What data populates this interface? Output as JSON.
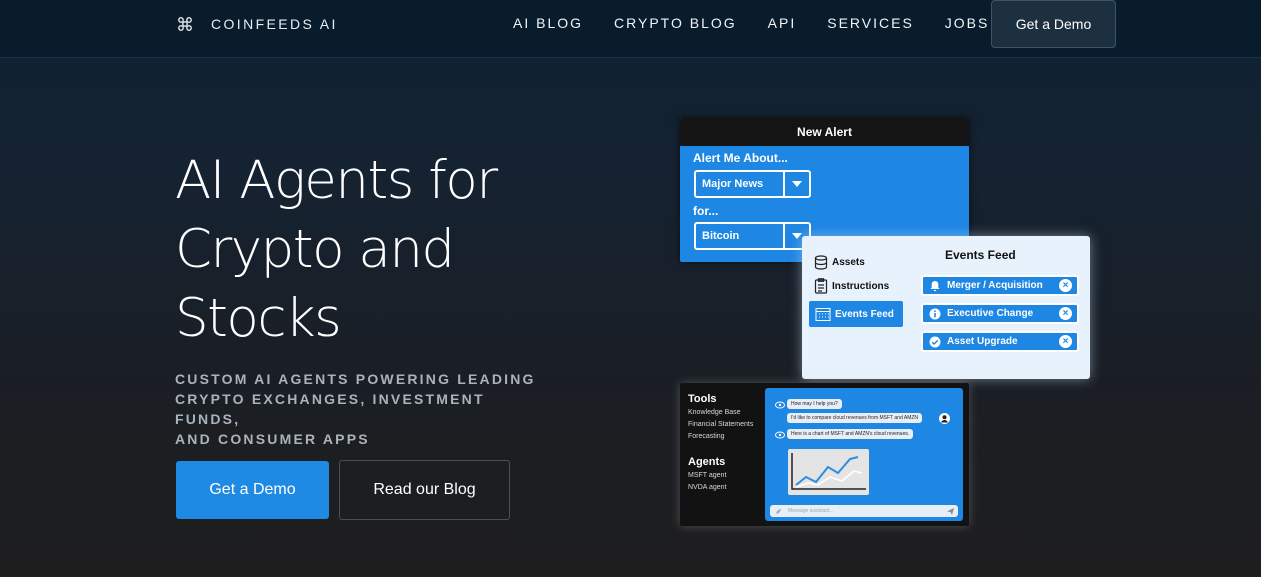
{
  "nav": {
    "brand": "COINFEEDS AI",
    "links": [
      "AI BLOG",
      "CRYPTO BLOG",
      "API",
      "SERVICES",
      "JOBS"
    ],
    "cta": "Get a Demo"
  },
  "hero": {
    "title_lines": [
      "AI Agents for",
      "Crypto and",
      "Stocks"
    ],
    "subtitle_lines": [
      "CUSTOM AI AGENTS POWERING LEADING",
      "CRYPTO EXCHANGES, INVESTMENT FUNDS,",
      "AND CONSUMER APPS"
    ],
    "primary_button": "Get a Demo",
    "secondary_button": "Read our Blog"
  },
  "alert_card": {
    "title": "New Alert",
    "label_about": "Alert Me About...",
    "select_topic": "Major News",
    "label_for": "for...",
    "select_asset": "Bitcoin"
  },
  "events_card": {
    "title": "Events Feed",
    "sidebar": [
      "Assets",
      "Instructions",
      "Events Feed"
    ],
    "events": [
      "Merger / Acquisition",
      "Executive Change",
      "Asset Upgrade"
    ]
  },
  "chat_card": {
    "tools_title": "Tools",
    "tools": [
      "Knowledge Base",
      "Financial Statements",
      "Forecasting"
    ],
    "agents_title": "Agents",
    "agents": [
      "MSFT agent",
      "NVDA agent"
    ],
    "messages": [
      "How may I help you?",
      "I'd like to compare cloud revenues from MSFT and AMZN",
      "Here is a chart of MSFT and AMZN's cloud revenues."
    ],
    "input_placeholder": "Message assistant..."
  },
  "colors": {
    "accent": "#1e8ae3",
    "nav_bg": "#081c2b"
  }
}
